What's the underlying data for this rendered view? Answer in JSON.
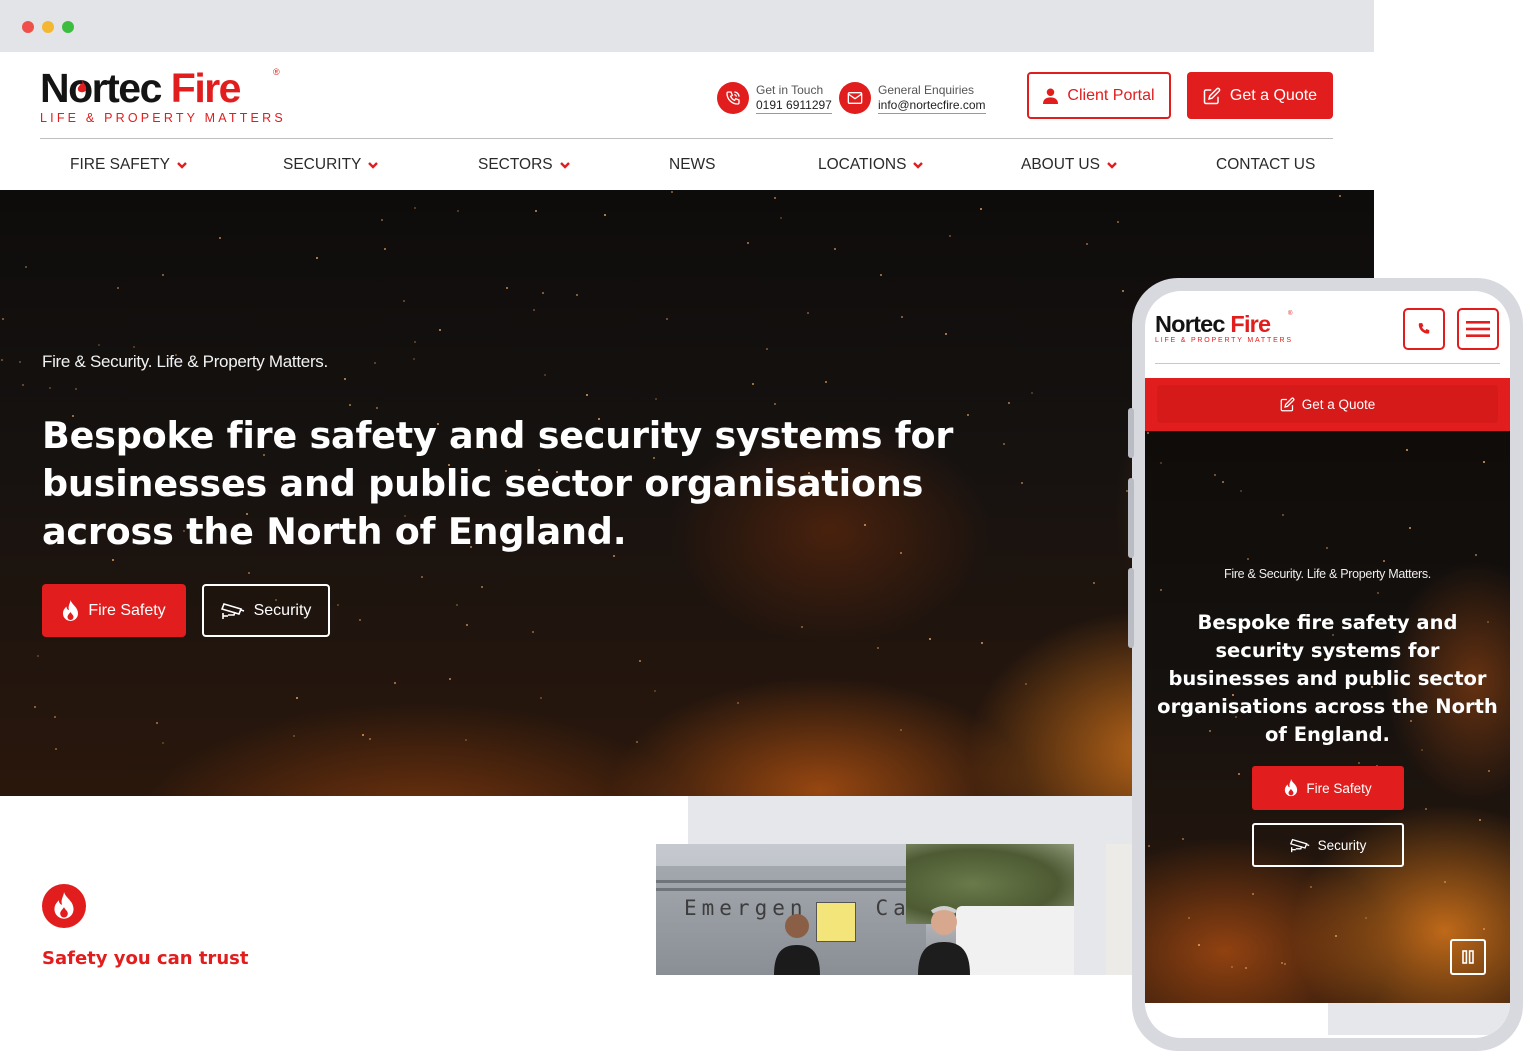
{
  "brand": {
    "logo_part1_a": "N",
    "logo_part1_b": "rtec",
    "logo_part2": "Fire",
    "registered": "®",
    "tagline": "LIFE & PROPERTY MATTERS",
    "accent_color": "#e11d1d"
  },
  "header": {
    "contact_phone": {
      "label": "Get in Touch",
      "value": "0191 6911297",
      "icon": "phone-icon"
    },
    "contact_email": {
      "label": "General Enquiries",
      "value": "info@nortecfire.com",
      "icon": "envelope-icon"
    },
    "client_portal_label": "Client Portal",
    "quote_label": "Get a Quote"
  },
  "nav": {
    "items": [
      {
        "label": "FIRE SAFETY",
        "has_dropdown": true
      },
      {
        "label": "SECURITY",
        "has_dropdown": true
      },
      {
        "label": "SECTORS",
        "has_dropdown": true
      },
      {
        "label": "NEWS",
        "has_dropdown": false
      },
      {
        "label": "LOCATIONS",
        "has_dropdown": true
      },
      {
        "label": "ABOUT US",
        "has_dropdown": true
      },
      {
        "label": "CONTACT US",
        "has_dropdown": false
      }
    ]
  },
  "hero": {
    "tagline": "Fire & Security. Life & Property Matters.",
    "title": "Bespoke fire safety and security systems for businesses and public sector organisations across the North of England.",
    "fire_button": "Fire Safety",
    "security_button": "Security"
  },
  "section": {
    "heading": "Safety you can trust",
    "photo_sign": "Emergen",
    "photo_sign_b": "Ca"
  },
  "mobile": {
    "quote_label": "Get a Quote",
    "hero_tagline": "Fire & Security. Life & Property Matters.",
    "hero_title": "Bespoke fire safety and security systems for businesses and public sector organisations across the North of England.",
    "fire_button": "Fire Safety",
    "security_button": "Security"
  }
}
